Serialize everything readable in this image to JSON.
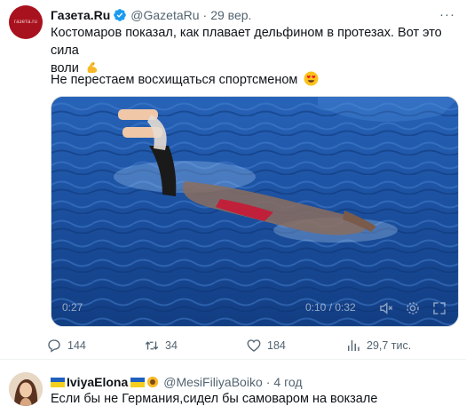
{
  "tweet": {
    "avatar_text": "газета.ru",
    "author_name": "Газета.Ru",
    "handle": "@GazetaRu",
    "separator": "·",
    "time": "29 вер.",
    "more_label": "···",
    "text_line1": "Костомаров показал, как плавает дельфином в протезах. Вот это сила",
    "text_line2": "воли",
    "text_line3": "Не перестаем восхищаться спортсменом",
    "emoji_1": "flexed-biceps-icon",
    "emoji_2": "heart-eyes-icon",
    "video": {
      "elapsed": "0:27",
      "progress": "0:10 / 0:32",
      "controls": [
        "mute-icon",
        "settings-icon",
        "fullscreen-icon"
      ]
    },
    "actions": {
      "replies": "144",
      "retweets": "34",
      "likes": "184",
      "views": "29,7 тис."
    }
  },
  "reply": {
    "author_name": "IviyaElona",
    "handle": "@MesiFiliyaBoiko",
    "separator": "·",
    "time": "4 год",
    "text": "Если бы не Германия,сидел бы самоваром на вокзале"
  },
  "colors": {
    "brand_red": "#a8121e",
    "verified_blue": "#1d9bf0",
    "muted": "#536471",
    "pool_blue": "#1a4fa0"
  }
}
